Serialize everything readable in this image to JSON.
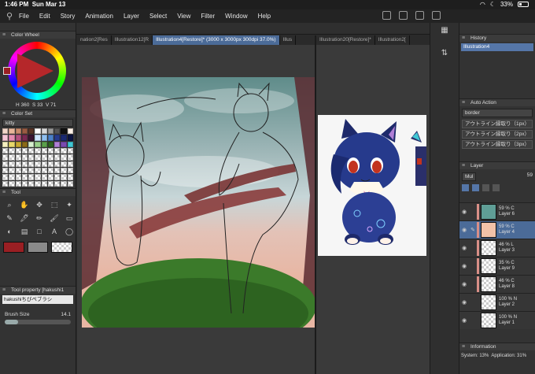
{
  "status": {
    "time": "1:46 PM",
    "date": "Sun Mar 13",
    "battery": "33%"
  },
  "menu": [
    "File",
    "Edit",
    "Story",
    "Animation",
    "Layer",
    "Select",
    "View",
    "Filter",
    "Window",
    "Help"
  ],
  "tabs_left": [
    "nation2[Res",
    "Illustration12[R",
    "Illustration4[Restore]* (3000 x 3000px 300dpi 37.0%)",
    "Illus"
  ],
  "tabs_right": [
    "Illustration20[Restore]*",
    "Illustration2["
  ],
  "color_wheel": {
    "title": "Color Wheel",
    "h": "360",
    "s": "33",
    "v": "71",
    "current_color": "#9a1f23"
  },
  "color_set": {
    "title": "Color Set",
    "set_name": "kitty"
  },
  "tool": {
    "title": "Tool"
  },
  "tool_property": {
    "title": "Tool property [hakushi1",
    "brush_name": "hakushiちびぺブラシ",
    "size_label": "Brush Size",
    "size_value": "14.1"
  },
  "history": {
    "title": "History",
    "items": [
      "Illustration4"
    ]
  },
  "auto_action": {
    "title": "Auto Action",
    "set": "border",
    "items": [
      "アウトライン縁取り（1px）",
      "アウトライン縁取り（2px）",
      "アウトライン縁取り（3px）"
    ]
  },
  "layer": {
    "title": "Layer",
    "blend_mode": "Mul",
    "opacity": "59",
    "layers": [
      {
        "pct": "59 %",
        "name": "Layer 6",
        "suffix": "C",
        "thumb": "#5f9e96"
      },
      {
        "pct": "59 %",
        "name": "Layer 4",
        "suffix": "C",
        "thumb": "#f2c2a8"
      },
      {
        "pct": "46 %",
        "name": "Layer 3",
        "suffix": "L",
        "thumb": "checker"
      },
      {
        "pct": "35 %",
        "name": "Layer 9",
        "suffix": "C",
        "thumb": "checker"
      },
      {
        "pct": "46 %",
        "name": "Layer 8",
        "suffix": "C",
        "thumb": "checker"
      },
      {
        "pct": "100 %",
        "name": "Layer 2",
        "suffix": "N",
        "thumb": "checker"
      },
      {
        "pct": "100 %",
        "name": "Layer 1",
        "suffix": "N",
        "thumb": "checker"
      }
    ]
  },
  "information": {
    "title": "Information",
    "system": "System: 13%",
    "application": "Application: 31%"
  }
}
